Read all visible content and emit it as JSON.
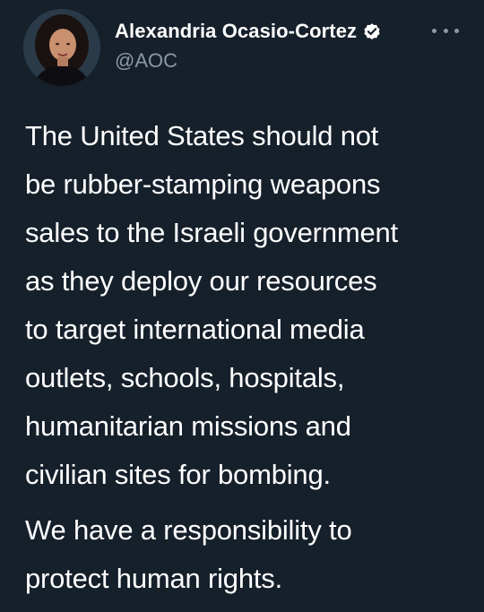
{
  "tweet": {
    "author": {
      "display_name": "Alexandria Ocasio-Cortez",
      "handle": "@AOC",
      "verified": true,
      "avatar_icon": "profile-photo"
    },
    "more_icon": "more-options-icon",
    "paragraphs": [
      {
        "lines": [
          "The United States should not",
          "be rubber-stamping weapons",
          "sales to the Israeli government",
          "as they deploy our resources",
          "to target international media",
          "outlets, schools, hospitals,",
          "humanitarian missions and",
          "civilian sites for bombing."
        ]
      },
      {
        "lines": [
          "We have a responsibility to",
          "protect human rights."
        ]
      }
    ]
  },
  "colors": {
    "background": "#15202b",
    "text": "#ffffff",
    "secondary_text": "#8b98a5",
    "verified_badge": "#ffffff"
  }
}
